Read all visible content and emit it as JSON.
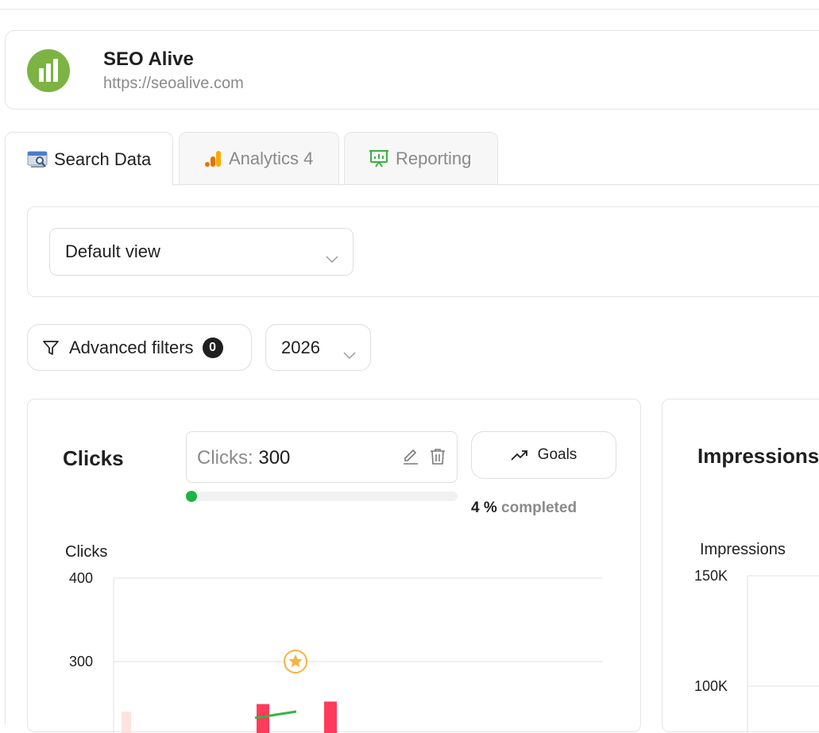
{
  "site": {
    "name": "SEO Alive",
    "url": "https://seoalive.com",
    "logo_color": "#7cb342"
  },
  "tabs": [
    {
      "label": "Search Data",
      "icon": "search-console-icon",
      "active": true
    },
    {
      "label": "Analytics 4",
      "icon": "analytics-icon",
      "active": false
    },
    {
      "label": "Reporting",
      "icon": "presentation-icon",
      "active": false
    }
  ],
  "view_select": {
    "value": "Default view"
  },
  "filters": {
    "label": "Advanced filters",
    "count": "0"
  },
  "year_select": {
    "value": "2026"
  },
  "clicks_card": {
    "title": "Clicks",
    "goal": {
      "label": "Clicks:",
      "value": "300",
      "progress": 0.04
    },
    "goals_button": "Goals",
    "completed": {
      "percent": "4 %",
      "label": "completed"
    }
  },
  "impressions_card": {
    "title": "Impressions"
  },
  "chart_data": [
    {
      "type": "bar",
      "ylabel": "Clicks",
      "ylim": [
        0,
        400
      ],
      "yticks": [
        "400",
        "300"
      ],
      "goal_line": 300,
      "bar_color": "#ff3b5c",
      "line_color": "#3cb043",
      "goal_color": "#f5b342",
      "values": [
        240,
        null,
        null,
        null,
        249,
        null,
        252
      ],
      "line_points": [
        [
          6,
          186
        ],
        [
          7,
          192
        ]
      ]
    },
    {
      "type": "bar",
      "ylabel": "Impressions",
      "yticks": [
        "150K",
        "100K"
      ],
      "ylim": [
        0,
        150000
      ]
    }
  ]
}
